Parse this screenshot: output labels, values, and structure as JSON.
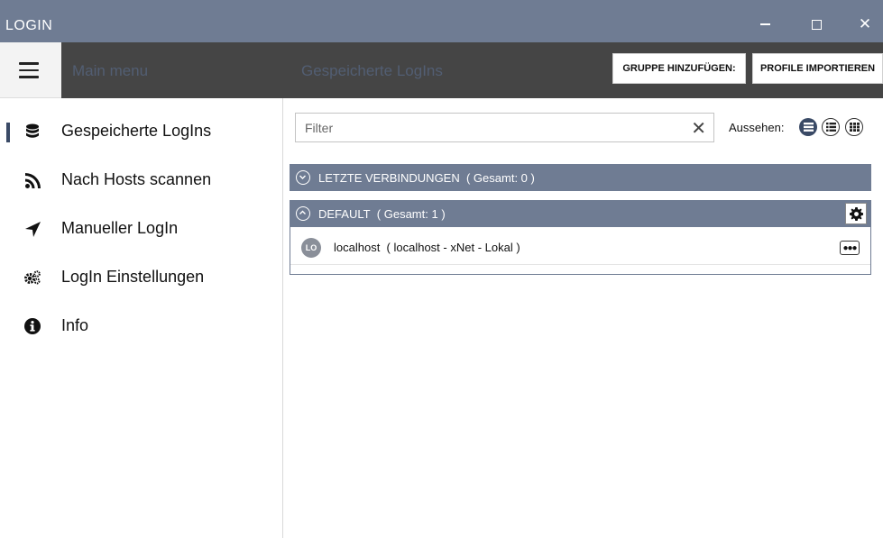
{
  "window": {
    "title": "LOGIN",
    "minimize_glyph": "—",
    "close_glyph": "✕"
  },
  "appbar": {
    "menu_label": "Main menu",
    "page_label": "Gespeicherte LogIns",
    "buttons": {
      "add_group": "GRUPPE HINZUFÜGEN:",
      "import_profiles": "PROFILE IMPORTIEREN"
    }
  },
  "sidebar": {
    "items": [
      {
        "label": "Gespeicherte LogIns",
        "icon": "database-icon",
        "selected": true
      },
      {
        "label": "Nach Hosts scannen",
        "icon": "rss-icon",
        "selected": false
      },
      {
        "label": "Manueller LogIn",
        "icon": "location-arrow-icon",
        "selected": false
      },
      {
        "label": "LogIn Einstellungen",
        "icon": "gears-icon",
        "selected": false
      },
      {
        "label": "Info",
        "icon": "info-circle-icon",
        "selected": false
      }
    ]
  },
  "content": {
    "filter": {
      "placeholder": "Filter",
      "value": "",
      "clear_glyph": "✕"
    },
    "view": {
      "label": "Aussehen:",
      "options": [
        "list-large-icon",
        "list-medium-icon",
        "grid-icon"
      ],
      "selected_index": 0
    },
    "groups": [
      {
        "title": "LETZTE VERBINDUNGEN",
        "count_text": "( Gesamt: 0 )",
        "expanded": false
      },
      {
        "title": "DEFAULT",
        "count_text": "( Gesamt: 1 )",
        "expanded": true,
        "entries": [
          {
            "avatar": "LO",
            "name": "localhost",
            "details": "( localhost - xNet -  Lokal )"
          }
        ]
      }
    ]
  },
  "colors": {
    "header": "#6f7c93",
    "appbar": "#454545",
    "accent": "#3a4a66"
  }
}
